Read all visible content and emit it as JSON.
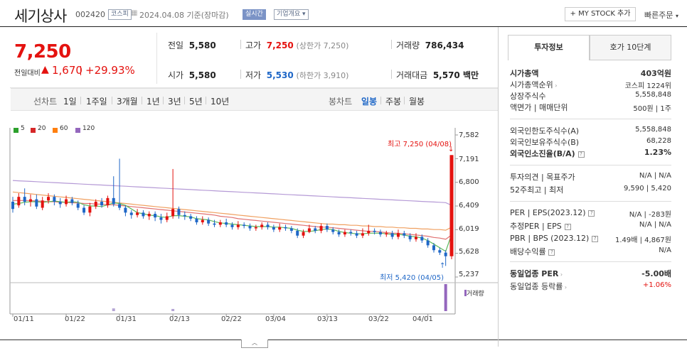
{
  "stock": {
    "name": "세기상사",
    "code": "002420",
    "market": "코스피",
    "date": "2024.04.08 기준(장마감)",
    "realtime": "실시간",
    "company_overview": "기업개요",
    "price": "7,250",
    "change_label": "전일대비",
    "change": "1,670",
    "change_pct": "+29.93%"
  },
  "actions": {
    "my_stock": "+ MY STOCK 추가",
    "quick_order": "빠른주문"
  },
  "summary": {
    "prev_close_label": "전일",
    "prev_close": "5,580",
    "high_label": "고가",
    "high": "7,250",
    "high_limit": "(상한가 7,250)",
    "volume_label": "거래량",
    "volume": "786,434",
    "open_label": "시가",
    "open": "5,580",
    "low_label": "저가",
    "low": "5,530",
    "low_limit": "(하한가 3,910)",
    "amount_label": "거래대금",
    "amount": "5,570 백만"
  },
  "periods": {
    "left": [
      "선차트",
      "1일",
      "1주일",
      "3개월",
      "1년",
      "3년",
      "5년",
      "10년"
    ],
    "right": [
      "봉차트",
      "일봉",
      "주봉",
      "월봉"
    ],
    "active_right": "일봉"
  },
  "legend": [
    {
      "label": "5",
      "color": "#2ca02c"
    },
    {
      "label": "20",
      "color": "#d62728"
    },
    {
      "label": "60",
      "color": "#ff7f0e"
    },
    {
      "label": "120",
      "color": "#9467bd"
    }
  ],
  "chart_data": {
    "type": "candlestick",
    "y_ticks": [
      "7,582",
      "7,191",
      "6,800",
      "6,409",
      "6,019",
      "5,628",
      "5,237"
    ],
    "ylim": [
      5237,
      7582
    ],
    "x_ticks": [
      "01/11",
      "01/22",
      "01/31",
      "02/13",
      "02/22",
      "03/04",
      "03/13",
      "03/22",
      "04/01"
    ],
    "high_annotation": "최고 7,250 (04/08)",
    "low_annotation": "최저 5,420 (04/05)",
    "volume_label": "거래량",
    "candles": [
      {
        "o": 6480,
        "c": 6360,
        "h": 6560,
        "l": 6300
      },
      {
        "o": 6420,
        "c": 6560,
        "h": 6620,
        "l": 6380
      },
      {
        "o": 6560,
        "c": 6480,
        "h": 6700,
        "l": 6420
      },
      {
        "o": 6480,
        "c": 6520,
        "h": 6600,
        "l": 6400
      },
      {
        "o": 6520,
        "c": 6400,
        "h": 6600,
        "l": 6360
      },
      {
        "o": 6380,
        "c": 6500,
        "h": 6560,
        "l": 6340
      },
      {
        "o": 6500,
        "c": 6560,
        "h": 6620,
        "l": 6450
      },
      {
        "o": 6560,
        "c": 6480,
        "h": 6600,
        "l": 6420
      },
      {
        "o": 6480,
        "c": 6440,
        "h": 6540,
        "l": 6380
      },
      {
        "o": 6440,
        "c": 6520,
        "h": 6580,
        "l": 6400
      },
      {
        "o": 6520,
        "c": 6460,
        "h": 6560,
        "l": 6420
      },
      {
        "o": 6450,
        "c": 6380,
        "h": 6500,
        "l": 6340
      },
      {
        "o": 6380,
        "c": 6300,
        "h": 6420,
        "l": 6260
      },
      {
        "o": 6300,
        "c": 6400,
        "h": 6460,
        "l": 6240
      },
      {
        "o": 6400,
        "c": 6480,
        "h": 6520,
        "l": 6360
      },
      {
        "o": 6480,
        "c": 6420,
        "h": 6540,
        "l": 6380
      },
      {
        "o": 6420,
        "c": 6540,
        "h": 6580,
        "l": 6380
      },
      {
        "o": 6540,
        "c": 6440,
        "h": 6900,
        "l": 6400
      },
      {
        "o": 6440,
        "c": 6380,
        "h": 7190,
        "l": 6340
      },
      {
        "o": 6380,
        "c": 6300,
        "h": 6420,
        "l": 6240
      },
      {
        "o": 6300,
        "c": 6260,
        "h": 6340,
        "l": 6200
      },
      {
        "o": 6260,
        "c": 6300,
        "h": 6360,
        "l": 6220
      },
      {
        "o": 6300,
        "c": 6240,
        "h": 6340,
        "l": 6200
      },
      {
        "o": 6240,
        "c": 6280,
        "h": 6320,
        "l": 6180
      },
      {
        "o": 6280,
        "c": 6220,
        "h": 6320,
        "l": 6160
      },
      {
        "o": 6220,
        "c": 6180,
        "h": 6280,
        "l": 6120
      },
      {
        "o": 6180,
        "c": 6240,
        "h": 6300,
        "l": 6140
      },
      {
        "o": 6240,
        "c": 6360,
        "h": 7020,
        "l": 6200
      },
      {
        "o": 6360,
        "c": 6260,
        "h": 6400,
        "l": 6200
      },
      {
        "o": 6260,
        "c": 6240,
        "h": 6320,
        "l": 6180
      },
      {
        "o": 6240,
        "c": 6200,
        "h": 6280,
        "l": 6160
      },
      {
        "o": 6200,
        "c": 6140,
        "h": 6240,
        "l": 6100
      },
      {
        "o": 6140,
        "c": 6180,
        "h": 6240,
        "l": 6100
      },
      {
        "o": 6180,
        "c": 6120,
        "h": 6220,
        "l": 6080
      },
      {
        "o": 6120,
        "c": 6100,
        "h": 6180,
        "l": 6060
      },
      {
        "o": 6100,
        "c": 6140,
        "h": 6180,
        "l": 6060
      },
      {
        "o": 6140,
        "c": 6100,
        "h": 6200,
        "l": 6060
      },
      {
        "o": 6100,
        "c": 6060,
        "h": 6140,
        "l": 6020
      },
      {
        "o": 6060,
        "c": 6100,
        "h": 6160,
        "l": 6020
      },
      {
        "o": 6100,
        "c": 6080,
        "h": 6140,
        "l": 6040
      },
      {
        "o": 6080,
        "c": 6040,
        "h": 6120,
        "l": 6000
      },
      {
        "o": 6040,
        "c": 6060,
        "h": 6100,
        "l": 6000
      },
      {
        "o": 6060,
        "c": 6100,
        "h": 6140,
        "l": 6020
      },
      {
        "o": 6100,
        "c": 6060,
        "h": 6140,
        "l": 6020
      },
      {
        "o": 6060,
        "c": 6020,
        "h": 6100,
        "l": 5980
      },
      {
        "o": 6020,
        "c": 6060,
        "h": 6120,
        "l": 5980
      },
      {
        "o": 6060,
        "c": 6040,
        "h": 6100,
        "l": 6000
      },
      {
        "o": 6040,
        "c": 6000,
        "h": 6080,
        "l": 5960
      },
      {
        "o": 6000,
        "c": 5920,
        "h": 6040,
        "l": 5880
      },
      {
        "o": 5920,
        "c": 5980,
        "h": 6020,
        "l": 5880
      },
      {
        "o": 5980,
        "c": 6040,
        "h": 6100,
        "l": 5960
      },
      {
        "o": 6040,
        "c": 6000,
        "h": 6080,
        "l": 5960
      },
      {
        "o": 6000,
        "c": 6080,
        "h": 6120,
        "l": 5960
      },
      {
        "o": 6080,
        "c": 6020,
        "h": 6120,
        "l": 5980
      },
      {
        "o": 6020,
        "c": 5980,
        "h": 6060,
        "l": 5940
      },
      {
        "o": 5980,
        "c": 5940,
        "h": 6020,
        "l": 5900
      },
      {
        "o": 5940,
        "c": 5980,
        "h": 6020,
        "l": 5900
      },
      {
        "o": 5980,
        "c": 5960,
        "h": 6020,
        "l": 5920
      },
      {
        "o": 5960,
        "c": 5920,
        "h": 6000,
        "l": 5880
      },
      {
        "o": 5920,
        "c": 5960,
        "h": 6040,
        "l": 5880
      },
      {
        "o": 5960,
        "c": 6000,
        "h": 6100,
        "l": 5920
      },
      {
        "o": 6000,
        "c": 5980,
        "h": 6040,
        "l": 5940
      },
      {
        "o": 5980,
        "c": 5940,
        "h": 6020,
        "l": 5900
      },
      {
        "o": 5940,
        "c": 5960,
        "h": 6000,
        "l": 5900
      },
      {
        "o": 5960,
        "c": 5900,
        "h": 6000,
        "l": 5860
      },
      {
        "o": 5900,
        "c": 5960,
        "h": 6020,
        "l": 5860
      },
      {
        "o": 5960,
        "c": 5920,
        "h": 6000,
        "l": 5880
      },
      {
        "o": 5920,
        "c": 5860,
        "h": 5960,
        "l": 5820
      },
      {
        "o": 5860,
        "c": 5900,
        "h": 5960,
        "l": 5820
      },
      {
        "o": 5900,
        "c": 5840,
        "h": 5940,
        "l": 5800
      },
      {
        "o": 5840,
        "c": 5760,
        "h": 5880,
        "l": 5720
      },
      {
        "o": 5760,
        "c": 5680,
        "h": 5800,
        "l": 5640
      },
      {
        "o": 5680,
        "c": 5640,
        "h": 5720,
        "l": 5600
      },
      {
        "o": 5640,
        "c": 5580,
        "h": 5680,
        "l": 5420
      },
      {
        "o": 5580,
        "c": 7250,
        "h": 7250,
        "l": 5530
      }
    ],
    "ma5": [
      6440,
      6450,
      6470,
      6480,
      6480,
      6470,
      6480,
      6490,
      6480,
      6470,
      6480,
      6470,
      6430,
      6410,
      6410,
      6400,
      6430,
      6460,
      6450,
      6420,
      6360,
      6300,
      6280,
      6260,
      6250,
      6230,
      6220,
      6250,
      6250,
      6240,
      6230,
      6200,
      6190,
      6180,
      6150,
      6130,
      6120,
      6110,
      6100,
      6090,
      6080,
      6070,
      6070,
      6070,
      6060,
      6060,
      6050,
      6040,
      6010,
      5990,
      5990,
      6000,
      6020,
      6030,
      6020,
      5990,
      5970,
      5960,
      5950,
      5950,
      5960,
      5960,
      5960,
      5950,
      5940,
      5940,
      5930,
      5910,
      5900,
      5880,
      5840,
      5780,
      5720,
      5660,
      5940
    ],
    "ma20": [
      6500,
      6500,
      6500,
      6500,
      6490,
      6490,
      6480,
      6480,
      6470,
      6470,
      6460,
      6460,
      6450,
      6450,
      6440,
      6440,
      6430,
      6430,
      6420,
      6410,
      6400,
      6390,
      6380,
      6370,
      6360,
      6350,
      6340,
      6330,
      6320,
      6310,
      6300,
      6290,
      6280,
      6270,
      6260,
      6240,
      6230,
      6220,
      6200,
      6190,
      6180,
      6170,
      6160,
      6150,
      6140,
      6130,
      6120,
      6110,
      6100,
      6090,
      6080,
      6070,
      6060,
      6060,
      6050,
      6040,
      6030,
      6020,
      6010,
      6000,
      5990,
      5990,
      5980,
      5970,
      5960,
      5960,
      5950,
      5940,
      5930,
      5920,
      5910,
      5890,
      5880,
      5860,
      5930
    ],
    "ma60": [
      6640,
      6630,
      6620,
      6610,
      6600,
      6590,
      6580,
      6570,
      6560,
      6550,
      6540,
      6530,
      6520,
      6510,
      6500,
      6490,
      6480,
      6470,
      6460,
      6450,
      6440,
      6430,
      6420,
      6410,
      6400,
      6390,
      6380,
      6370,
      6360,
      6350,
      6340,
      6330,
      6320,
      6310,
      6300,
      6290,
      6280,
      6270,
      6260,
      6250,
      6240,
      6230,
      6220,
      6210,
      6200,
      6190,
      6180,
      6170,
      6160,
      6150,
      6140,
      6130,
      6120,
      6110,
      6110,
      6100,
      6100,
      6090,
      6090,
      6080,
      6080,
      6070,
      6070,
      6060,
      6060,
      6050,
      6050,
      6040,
      6040,
      6030,
      6030,
      6020,
      6020,
      6010,
      6060
    ],
    "ma120": [
      6830,
      6825,
      6820,
      6815,
      6810,
      6805,
      6800,
      6795,
      6790,
      6785,
      6780,
      6775,
      6770,
      6765,
      6760,
      6755,
      6750,
      6745,
      6740,
      6735,
      6730,
      6725,
      6720,
      6715,
      6710,
      6705,
      6700,
      6695,
      6690,
      6685,
      6680,
      6675,
      6670,
      6665,
      6660,
      6655,
      6650,
      6645,
      6640,
      6635,
      6630,
      6625,
      6620,
      6615,
      6610,
      6605,
      6600,
      6595,
      6590,
      6585,
      6580,
      6575,
      6570,
      6565,
      6560,
      6555,
      6550,
      6545,
      6540,
      6535,
      6530,
      6525,
      6520,
      6515,
      6510,
      6505,
      6500,
      6495,
      6490,
      6485,
      6480,
      6475,
      6470,
      6465,
      6420
    ],
    "volume_spikes": [
      {
        "i": 17,
        "v": 0.1
      },
      {
        "i": 27,
        "v": 0.08
      },
      {
        "i": 73,
        "v": 1.0
      }
    ]
  },
  "right_panel": {
    "tabs": [
      "투자정보",
      "호가 10단계"
    ],
    "market_cap_label": "시가총액",
    "market_cap": "403억원",
    "rank_label": "시가총액순위",
    "rank": "코스피 1224위",
    "shares_label": "상장주식수",
    "shares": "5,558,848",
    "par_label": "액면가 | 매매단위",
    "par": "500원 | 1주",
    "foreign_limit_label": "외국인한도주식수(A)",
    "foreign_limit": "5,558,848",
    "foreign_hold_label": "외국인보유주식수(B)",
    "foreign_hold": "68,228",
    "foreign_ratio_label": "외국인소진율(B/A)",
    "foreign_ratio": "1.23%",
    "opinion_label": "투자의견 | 목표주가",
    "opinion": "N/A | N/A",
    "w52_label": "52주최고 | 최저",
    "w52": "9,590 | 5,420",
    "per_label": "PER | EPS(2023.12)",
    "per": "N/A | -283원",
    "est_per_label": "추정PER | EPS",
    "est_per": "N/A | N/A",
    "pbr_label": "PBR | BPS (2023.12)",
    "pbr": "1.49배 | 4,867원",
    "div_label": "배당수익률",
    "div": "N/A",
    "sector_per_label": "동일업종 PER",
    "sector_per": "-5.00배",
    "sector_chg_label": "동일업종 등락률",
    "sector_chg": "+1.06%"
  }
}
